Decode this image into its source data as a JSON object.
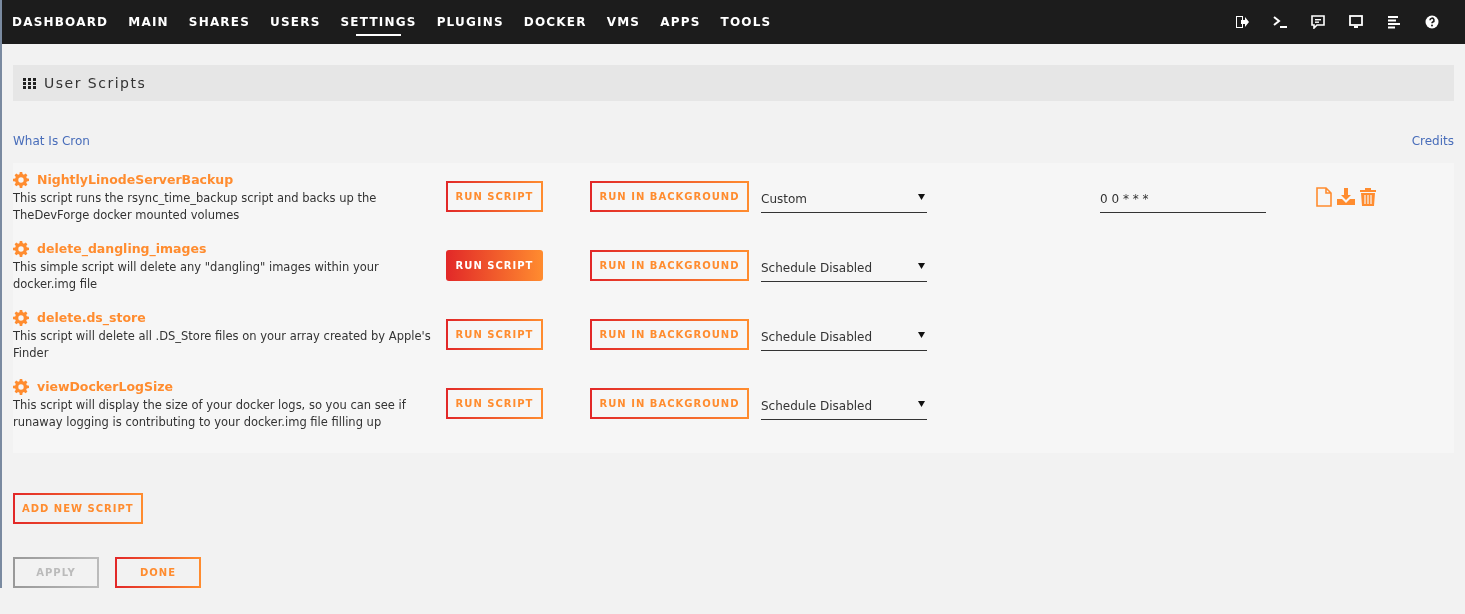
{
  "nav": {
    "tabs": [
      {
        "label": "DASHBOARD",
        "selected": false
      },
      {
        "label": "MAIN",
        "selected": false
      },
      {
        "label": "SHARES",
        "selected": false
      },
      {
        "label": "USERS",
        "selected": false
      },
      {
        "label": "SETTINGS",
        "selected": true
      },
      {
        "label": "PLUGINS",
        "selected": false
      },
      {
        "label": "DOCKER",
        "selected": false
      },
      {
        "label": "VMS",
        "selected": false
      },
      {
        "label": "APPS",
        "selected": false
      },
      {
        "label": "TOOLS",
        "selected": false
      }
    ]
  },
  "section": {
    "title": "User Scripts"
  },
  "links": {
    "left": "What Is Cron",
    "right": "Credits"
  },
  "scripts": [
    {
      "name": "NightlyLinodeServerBackup",
      "description": "This script runs the rsync_time_backup script and backs up the TheDevForge docker mounted volumes",
      "run_label": "RUN SCRIPT",
      "run_hovered": false,
      "background_label": "RUN IN BACKGROUND",
      "schedule": "Custom",
      "cron": "0 0 * * *",
      "show_actions": true
    },
    {
      "name": "delete_dangling_images",
      "description": "This simple script will delete any \"dangling\" images within your docker.img file",
      "run_label": "RUN SCRIPT",
      "run_hovered": true,
      "background_label": "RUN IN BACKGROUND",
      "schedule": "Schedule Disabled",
      "show_actions": false
    },
    {
      "name": "delete.ds_store",
      "description": "This script will delete all .DS_Store files on your array created by Apple's Finder",
      "run_label": "RUN SCRIPT",
      "run_hovered": false,
      "background_label": "RUN IN BACKGROUND",
      "schedule": "Schedule Disabled",
      "show_actions": false
    },
    {
      "name": "viewDockerLogSize",
      "description": "This script will display the size of your docker logs, so you can see if runaway logging is contributing to your docker.img file filling up",
      "run_label": "RUN SCRIPT",
      "run_hovered": false,
      "background_label": "RUN IN BACKGROUND",
      "schedule": "Schedule Disabled",
      "show_actions": false
    }
  ],
  "add_button": "ADD NEW SCRIPT",
  "buttons": [
    {
      "label": "APPLY",
      "disabled": true
    },
    {
      "label": "DONE",
      "disabled": false
    }
  ]
}
